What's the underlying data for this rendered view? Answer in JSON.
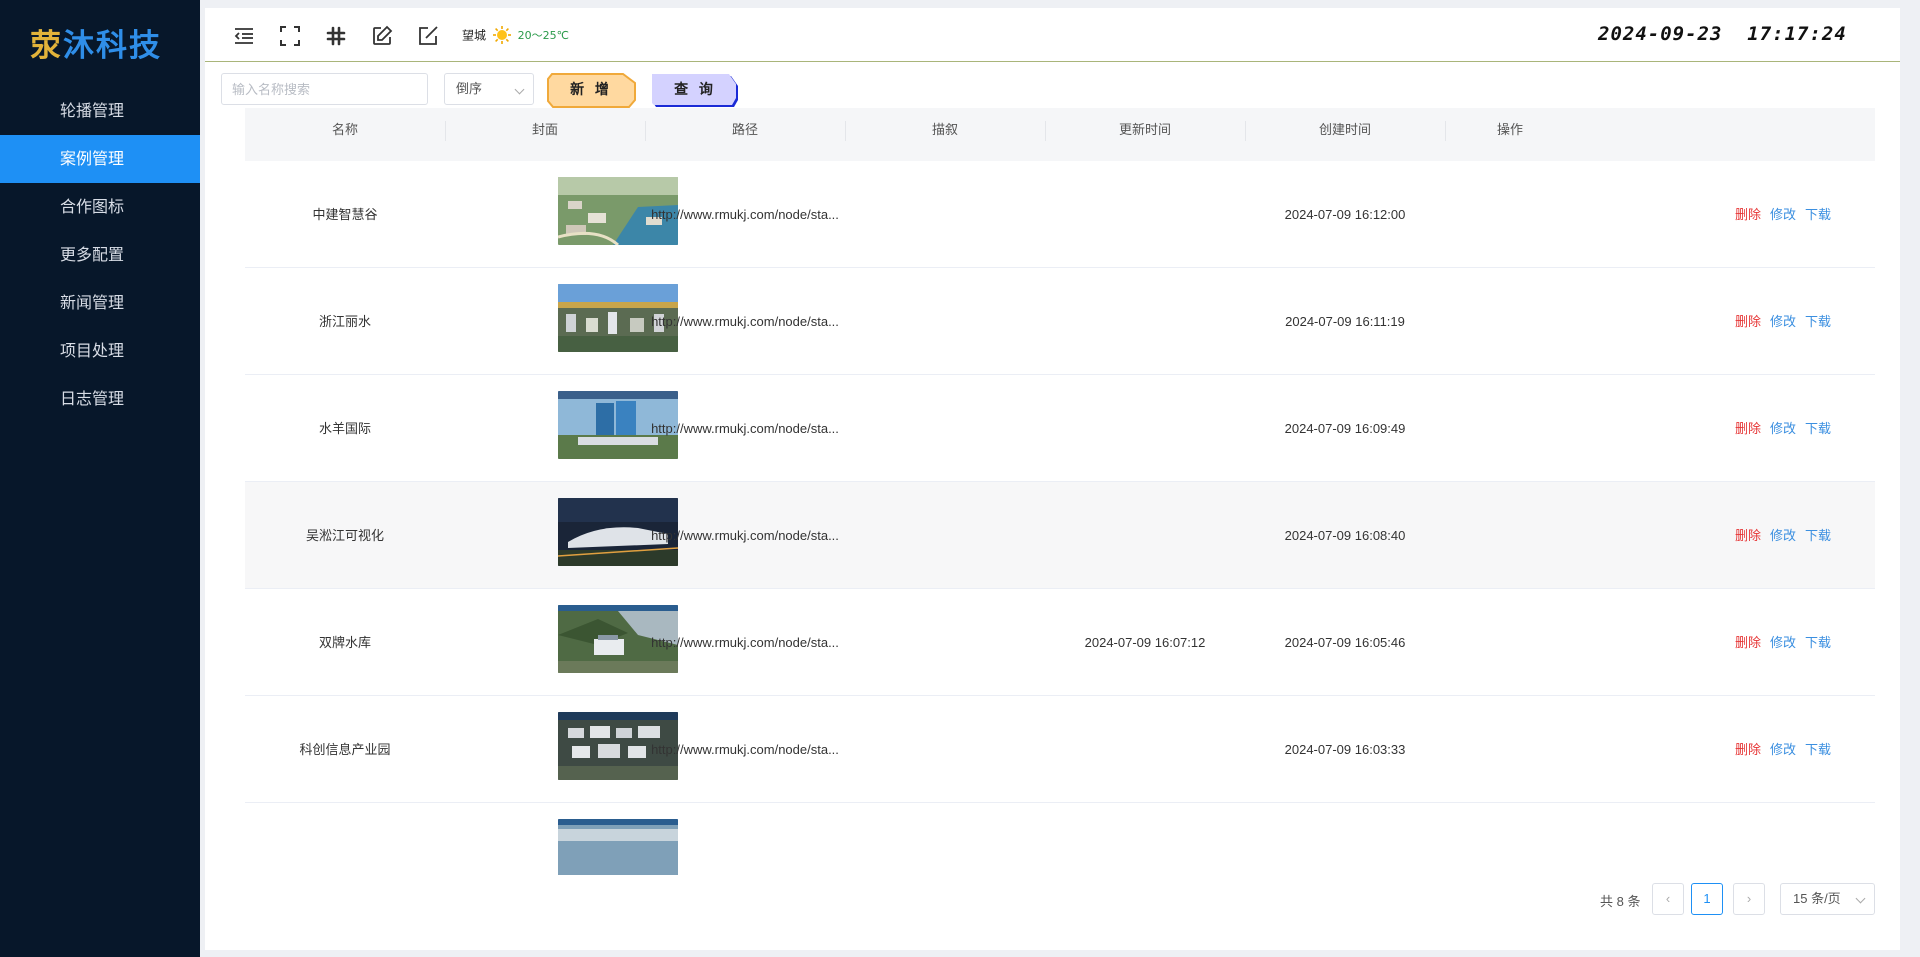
{
  "app": {
    "logo_first": "荥",
    "logo_rest": "沐科技"
  },
  "sidebar": {
    "items": [
      {
        "label": "轮播管理",
        "active": false
      },
      {
        "label": "案例管理",
        "active": true
      },
      {
        "label": "合作图标",
        "active": false
      },
      {
        "label": "更多配置",
        "active": false
      },
      {
        "label": "新闻管理",
        "active": false
      },
      {
        "label": "项目处理",
        "active": false
      },
      {
        "label": "日志管理",
        "active": false
      }
    ]
  },
  "topbar": {
    "icons": [
      "menu-fold-icon",
      "fullscreen-icon",
      "slack-icon",
      "edit-icon",
      "edit-square-icon"
    ],
    "weather": {
      "city": "望城",
      "icon": "sun-icon",
      "temp": "20～25℃"
    },
    "datetime": "2024-09-23  17:17:24"
  },
  "toolbar": {
    "search_placeholder": "输入名称搜索",
    "search_value": "",
    "sort_value": "倒序",
    "add_label": "新 增",
    "query_label": "查 询"
  },
  "table": {
    "columns": [
      "名称",
      "封面",
      "路径",
      "描叙",
      "更新时间",
      "创建时间",
      "操作"
    ],
    "rows": [
      {
        "name": "中建智慧谷",
        "cover": "thumb-aerial-city",
        "path": "http://www.rmukj.com/node/sta...",
        "desc": "",
        "updated": "",
        "created": "2024-07-09 16:12:00"
      },
      {
        "name": "浙江丽水",
        "cover": "thumb-city-dashboard",
        "path": "http://www.rmukj.com/node/sta...",
        "desc": "",
        "updated": "",
        "created": "2024-07-09 16:11:19"
      },
      {
        "name": "水羊国际",
        "cover": "thumb-glass-towers",
        "path": "http://www.rmukj.com/node/sta...",
        "desc": "",
        "updated": "",
        "created": "2024-07-09 16:09:49"
      },
      {
        "name": "吴淞江可视化",
        "cover": "thumb-night-building",
        "path": "http://www.rmukj.com/node/sta...",
        "desc": "",
        "updated": "",
        "created": "2024-07-09 16:08:40"
      },
      {
        "name": "双牌水库",
        "cover": "thumb-reservoir",
        "path": "http://www.rmukj.com/node/sta...",
        "desc": "",
        "updated": "2024-07-09 16:07:12",
        "created": "2024-07-09 16:05:46"
      },
      {
        "name": "科创信息产业园",
        "cover": "thumb-industrial-park",
        "path": "http://www.rmukj.com/node/sta...",
        "desc": "",
        "updated": "",
        "created": "2024-07-09 16:03:33"
      }
    ],
    "actions": {
      "delete": "删除",
      "edit": "修改",
      "download": "下载"
    }
  },
  "pagination": {
    "total": "共 8 条",
    "current_page": "1",
    "page_size": "15 条/页"
  },
  "colors": {
    "sidebar_bg": "#07172a",
    "active_item": "#1e90f5",
    "delete": "#e63434",
    "link": "#3b8fe0",
    "add_button": "#ffd9a0",
    "query_button": "#d4d2ff"
  }
}
